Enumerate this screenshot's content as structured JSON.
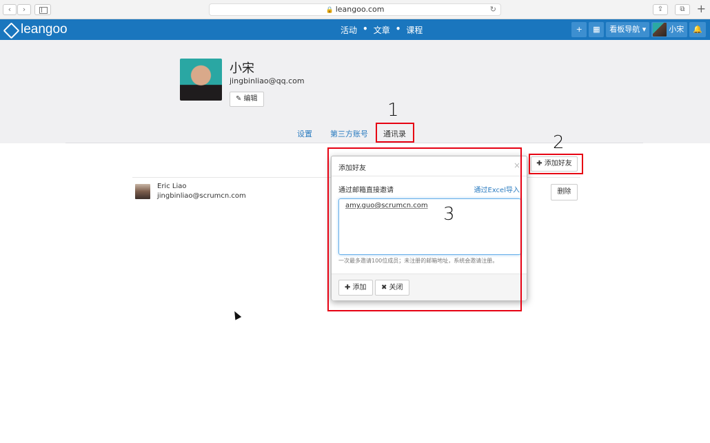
{
  "browser": {
    "url": "leangoo.com",
    "back_glyph": "‹",
    "forward_glyph": "›",
    "lock_glyph": "🔒",
    "reload_glyph": "↻",
    "share_glyph": "⇪",
    "tabs_glyph": "⧉",
    "new_tab_glyph": "+"
  },
  "topnav": {
    "logo_text": "leangoo",
    "links": [
      "活动",
      "文章",
      "课程"
    ],
    "separator": "•",
    "plus_glyph": "+",
    "grid_glyph": "▦",
    "board_nav_label": "看板导航",
    "caret_glyph": "▾",
    "user_name": "小宋",
    "bell_glyph": "🔔",
    "brand_color": "#1a76be"
  },
  "profile": {
    "name": "小宋",
    "email": "jingbinliao@qq.com",
    "edit_label": "✎ 编辑",
    "tabs": [
      "设置",
      "第三方账号",
      "通讯录"
    ],
    "active_tab": "通讯录"
  },
  "contacts": {
    "add_friend_label": "✚ 添加好友",
    "items": [
      {
        "name": "Eric Liao",
        "email": "jingbinliao@scrumcn.com",
        "delete_label": "删除"
      }
    ]
  },
  "modal": {
    "title": "添加好友",
    "close_glyph": "×",
    "invite_label": "通过邮箱直接邀请",
    "excel_link": "通过Excel导入",
    "textarea_value": "amy.guo@scrumcn.com",
    "hint": "一次最多邀请100位成员；未注册的邮箱地址，系统会邀请注册。",
    "add_label": "✚ 添加",
    "close_label": "✖ 关闭"
  },
  "annotations": {
    "labels": [
      "1",
      "2",
      "3"
    ],
    "color": "#e60012"
  }
}
